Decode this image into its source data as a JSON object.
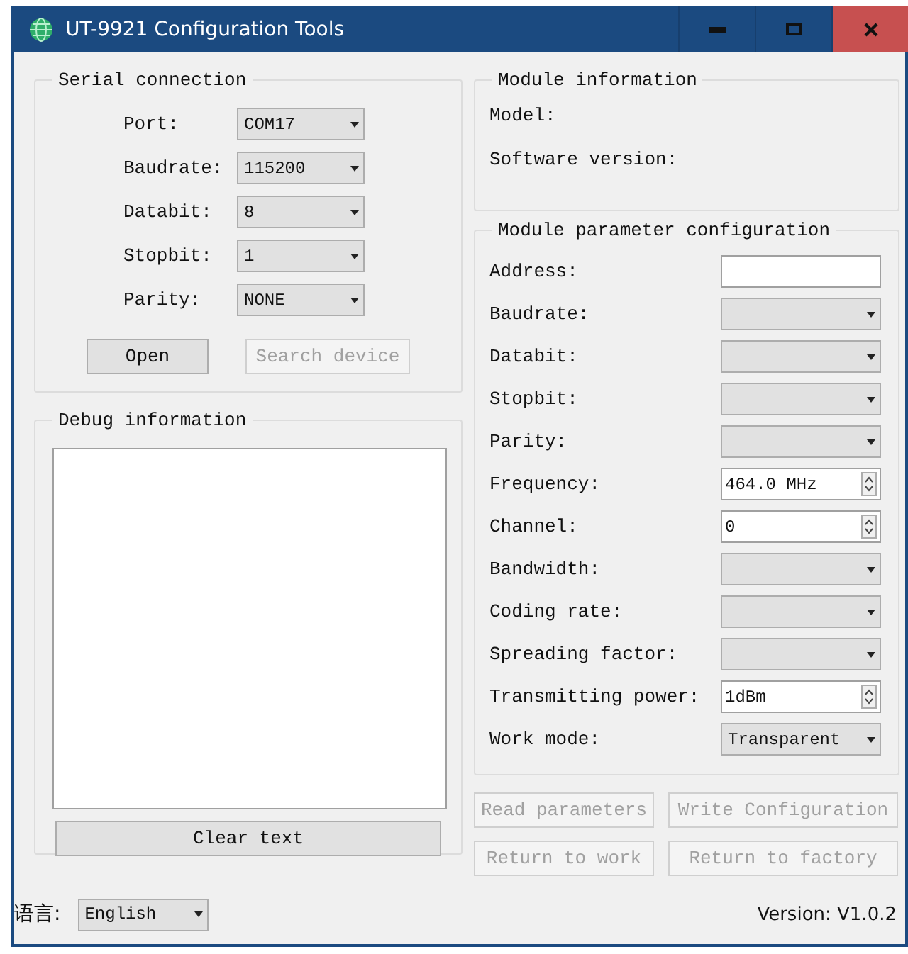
{
  "window": {
    "title": "UT-9921 Configuration Tools"
  },
  "serial_connection": {
    "title": "Serial connection",
    "fields": [
      {
        "label": "Port:",
        "value": "COM17"
      },
      {
        "label": "Baudrate:",
        "value": "115200"
      },
      {
        "label": "Databit:",
        "value": "8"
      },
      {
        "label": "Stopbit:",
        "value": "1"
      },
      {
        "label": "Parity:",
        "value": "NONE"
      }
    ],
    "buttons": [
      {
        "label": "Open",
        "disabled": false
      },
      {
        "label": "Search device",
        "disabled": true
      }
    ]
  },
  "debug_information": {
    "title": "Debug information",
    "button": "Clear text"
  },
  "module_information": {
    "title": "Module information",
    "items": [
      "Model:",
      "Software version:"
    ]
  },
  "module_parameter_configuration": {
    "title": "Module parameter configuration",
    "fields": [
      {
        "label": "Address:",
        "kind": "text"
      },
      {
        "label": "Baudrate:",
        "kind": "combo"
      },
      {
        "label": "Databit:",
        "kind": "combo"
      },
      {
        "label": "Stopbit:",
        "kind": "combo"
      },
      {
        "label": "Parity:",
        "kind": "combo"
      },
      {
        "label": "Frequency:",
        "kind": "spin",
        "value": "464.0 MHz"
      },
      {
        "label": "Channel:",
        "kind": "spin",
        "value": "0"
      },
      {
        "label": "Bandwidth:",
        "kind": "combo"
      },
      {
        "label": "Coding rate:",
        "kind": "combo"
      },
      {
        "label": "Spreading factor:",
        "kind": "combo"
      },
      {
        "label": "Transmitting power:",
        "kind": "spin",
        "value": "1dBm"
      },
      {
        "label": "Work mode:",
        "kind": "combo",
        "value": "Transparent"
      }
    ]
  },
  "action_buttons": [
    {
      "label": "Read parameters",
      "disabled": true
    },
    {
      "label": "Write Configuration",
      "disabled": true
    },
    {
      "label": "Return to work",
      "disabled": true
    },
    {
      "label": "Return to factory",
      "disabled": true
    }
  ],
  "status_bar": {
    "language_label": "语言:",
    "language": "English",
    "version": "Version: V1.0.2"
  }
}
